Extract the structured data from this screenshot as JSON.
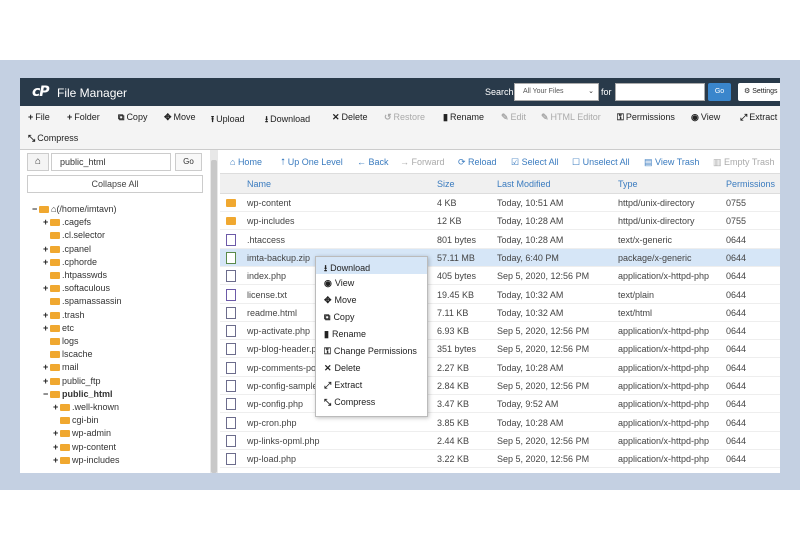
{
  "header": {
    "logo": "cP",
    "title": "File Manager",
    "search_label": "Search",
    "search_scope": "All Your Files",
    "for_label": "for",
    "go_label": "Go",
    "settings_label": "Settings"
  },
  "toolbar": {
    "file": "File",
    "folder": "Folder",
    "copy": "Copy",
    "move": "Move",
    "upload": "Upload",
    "download": "Download",
    "delete": "Delete",
    "restore": "Restore",
    "rename": "Rename",
    "edit": "Edit",
    "html_editor": "HTML Editor",
    "permissions": "Permissions",
    "view": "View",
    "extract": "Extract",
    "compress": "Compress"
  },
  "left": {
    "path": "public_html",
    "go": "Go",
    "collapse_all": "Collapse All",
    "tree": [
      {
        "label": "(/home/imtavn)",
        "toggle": "−",
        "home": true
      },
      {
        "label": ".cagefs",
        "toggle": "+"
      },
      {
        "label": ".cl.selector",
        "toggle": ""
      },
      {
        "label": ".cpanel",
        "toggle": "+"
      },
      {
        "label": ".cphorde",
        "toggle": "+"
      },
      {
        "label": ".htpasswds",
        "toggle": ""
      },
      {
        "label": ".softaculous",
        "toggle": "+"
      },
      {
        "label": ".spamassassin",
        "toggle": ""
      },
      {
        "label": ".trash",
        "toggle": "+"
      },
      {
        "label": "etc",
        "toggle": "+"
      },
      {
        "label": "logs",
        "toggle": ""
      },
      {
        "label": "lscache",
        "toggle": ""
      },
      {
        "label": "mail",
        "toggle": "+"
      },
      {
        "label": "public_ftp",
        "toggle": "+"
      },
      {
        "label": "public_html",
        "toggle": "−",
        "bold": true
      },
      {
        "label": ".well-known",
        "toggle": "+"
      },
      {
        "label": "cgi-bin",
        "toggle": ""
      },
      {
        "label": "wp-admin",
        "toggle": "+"
      },
      {
        "label": "wp-content",
        "toggle": "+"
      },
      {
        "label": "wp-includes",
        "toggle": "+"
      }
    ]
  },
  "nav": {
    "home": "Home",
    "up_one_level": "Up One Level",
    "back": "Back",
    "forward": "Forward",
    "reload": "Reload",
    "select_all": "Select All",
    "unselect_all": "Unselect All",
    "view_trash": "View Trash",
    "empty_trash": "Empty Trash"
  },
  "columns": [
    "Name",
    "Size",
    "Last Modified",
    "Type",
    "Permissions"
  ],
  "files": [
    {
      "name": "wp-content",
      "size": "4 KB",
      "modified": "Today, 10:51 AM",
      "type": "httpd/unix-directory",
      "perm": "0755",
      "icon": "folder"
    },
    {
      "name": "wp-includes",
      "size": "12 KB",
      "modified": "Today, 10:28 AM",
      "type": "httpd/unix-directory",
      "perm": "0755",
      "icon": "folder"
    },
    {
      "name": ".htaccess",
      "size": "801 bytes",
      "modified": "Today, 10:28 AM",
      "type": "text/x-generic",
      "perm": "0644",
      "icon": "doc"
    },
    {
      "name": "imta-backup.zip",
      "size": "57.11 MB",
      "modified": "Today, 6:40 PM",
      "type": "package/x-generic",
      "perm": "0644",
      "icon": "zip",
      "selected": true
    },
    {
      "name": "index.php",
      "size": "405 bytes",
      "modified": "Sep 5, 2020, 12:56 PM",
      "type": "application/x-httpd-php",
      "perm": "0644",
      "icon": "php"
    },
    {
      "name": "license.txt",
      "size": "19.45 KB",
      "modified": "Today, 10:32 AM",
      "type": "text/plain",
      "perm": "0644",
      "icon": "txt"
    },
    {
      "name": "readme.html",
      "size": "7.11 KB",
      "modified": "Today, 10:32 AM",
      "type": "text/html",
      "perm": "0644",
      "icon": "php"
    },
    {
      "name": "wp-activate.php",
      "size": "6.93 KB",
      "modified": "Sep 5, 2020, 12:56 PM",
      "type": "application/x-httpd-php",
      "perm": "0644",
      "icon": "php"
    },
    {
      "name": "wp-blog-header.php",
      "size": "351 bytes",
      "modified": "Sep 5, 2020, 12:56 PM",
      "type": "application/x-httpd-php",
      "perm": "0644",
      "icon": "php"
    },
    {
      "name": "wp-comments-post.php",
      "size": "2.27 KB",
      "modified": "Today, 10:28 AM",
      "type": "application/x-httpd-php",
      "perm": "0644",
      "icon": "php"
    },
    {
      "name": "wp-config-sample.php",
      "size": "2.84 KB",
      "modified": "Sep 5, 2020, 12:56 PM",
      "type": "application/x-httpd-php",
      "perm": "0644",
      "icon": "php"
    },
    {
      "name": "wp-config.php",
      "size": "3.47 KB",
      "modified": "Today, 9:52 AM",
      "type": "application/x-httpd-php",
      "perm": "0644",
      "icon": "php"
    },
    {
      "name": "wp-cron.php",
      "size": "3.85 KB",
      "modified": "Today, 10:28 AM",
      "type": "application/x-httpd-php",
      "perm": "0644",
      "icon": "php"
    },
    {
      "name": "wp-links-opml.php",
      "size": "2.44 KB",
      "modified": "Sep 5, 2020, 12:56 PM",
      "type": "application/x-httpd-php",
      "perm": "0644",
      "icon": "php"
    },
    {
      "name": "wp-load.php",
      "size": "3.22 KB",
      "modified": "Sep 5, 2020, 12:56 PM",
      "type": "application/x-httpd-php",
      "perm": "0644",
      "icon": "php"
    }
  ],
  "context_menu": {
    "download": "Download",
    "view": "View",
    "move": "Move",
    "copy": "Copy",
    "rename": "Rename",
    "change_permissions": "Change Permissions",
    "delete": "Delete",
    "extract": "Extract",
    "compress": "Compress"
  }
}
